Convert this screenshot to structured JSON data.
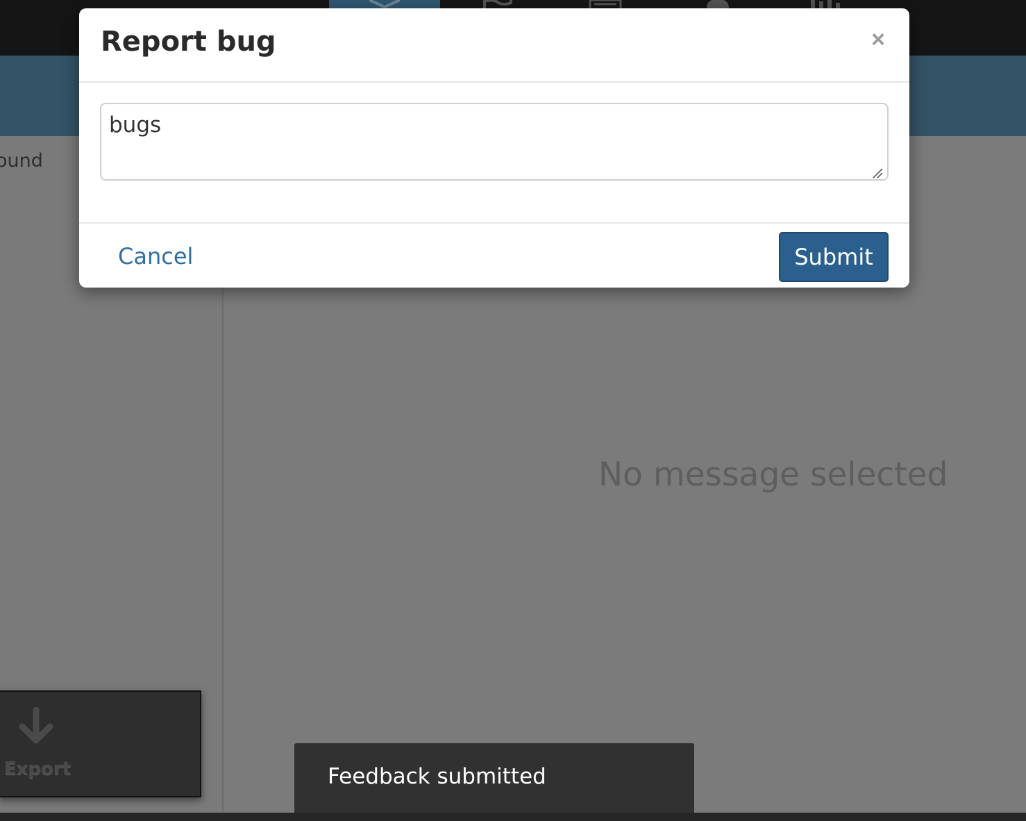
{
  "app": {
    "nav_icons": [
      "inbox-icon",
      "flag-icon",
      "list-icon",
      "user-icon",
      "bar-chart-icon"
    ],
    "sidebar_text": "ound",
    "empty_state": "No message selected",
    "export_label": "Export"
  },
  "modal": {
    "title": "Report bug",
    "close_symbol": "×",
    "textarea_value": "bugs",
    "cancel_label": "Cancel",
    "submit_label": "Submit"
  },
  "toast": {
    "message": "Feedback submitted"
  },
  "colors": {
    "primary": "#2b5f8d",
    "link": "#2f6ea3",
    "subheader": "#335366",
    "toast_bg": "#313131"
  }
}
